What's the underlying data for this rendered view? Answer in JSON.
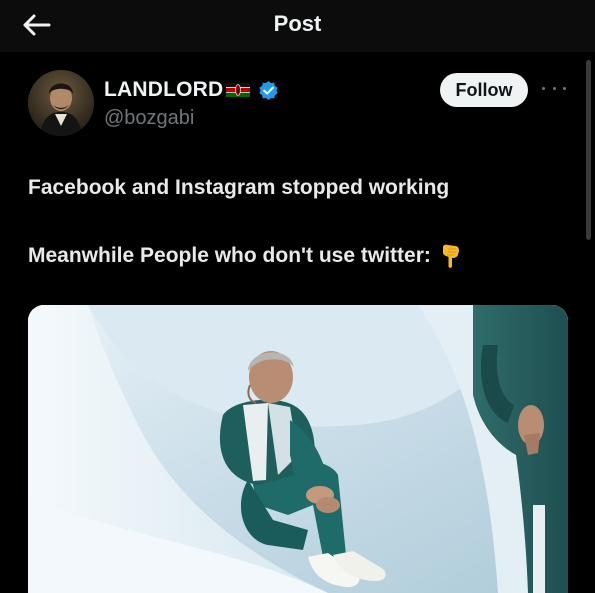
{
  "header": {
    "title": "Post",
    "back_icon": "arrow-left-icon"
  },
  "author": {
    "display_name": "LANDLORD",
    "flag": "kenya-flag",
    "verified_icon": "verified-badge-icon",
    "handle": "@bozgabi",
    "avatar": "avatar"
  },
  "actions": {
    "follow_label": "Follow",
    "more_icon": "more-options-icon"
  },
  "post": {
    "line1": "Facebook and Instagram stopped working",
    "line2": "Meanwhile People who don't use twitter:",
    "emoji": "backhand-index-pointing-down"
  },
  "colors": {
    "background": "#000000",
    "text": "#e7e9ea",
    "secondary_text": "#71767b",
    "verified_blue": "#1d9bf0",
    "follow_bg": "#eff3f4"
  }
}
